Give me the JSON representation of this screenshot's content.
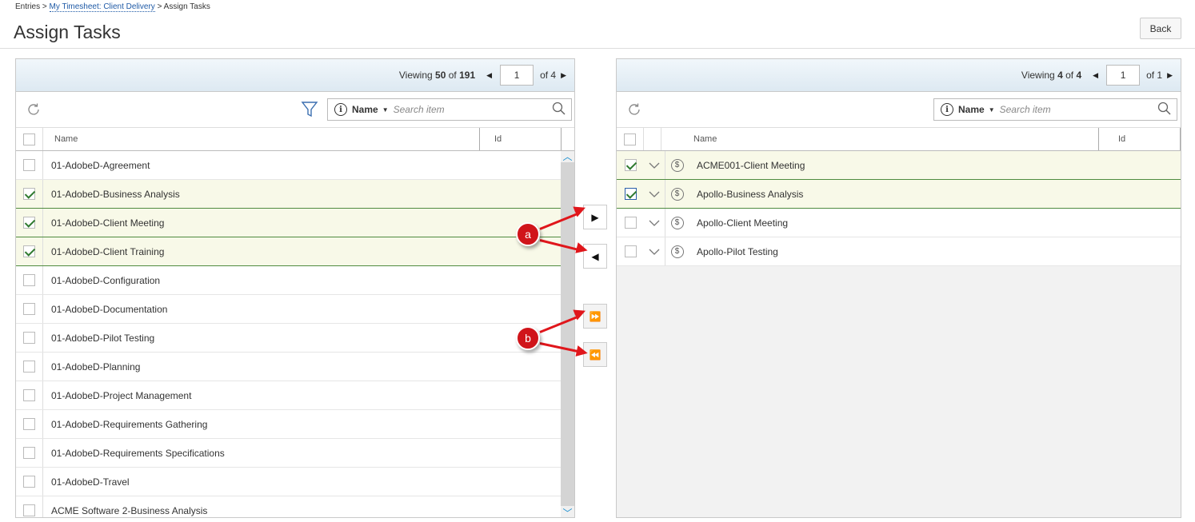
{
  "breadcrumb": {
    "root": "Entries",
    "sep1": " > ",
    "link": "My Timesheet: Client Delivery",
    "sep2": " > ",
    "current": "Assign Tasks"
  },
  "page_title": "Assign Tasks",
  "back_label": "Back",
  "left_panel": {
    "viewing_label": "Viewing",
    "viewing_count": "50",
    "viewing_of": "of",
    "viewing_total": "191",
    "page_value": "1",
    "page_of": "of 4",
    "search": {
      "field": "Name",
      "placeholder": "Search item"
    },
    "columns": {
      "name": "Name",
      "id": "Id"
    },
    "rows": [
      {
        "name": "01-AdobeD-Agreement",
        "checked": false
      },
      {
        "name": "01-AdobeD-Business Analysis",
        "checked": true
      },
      {
        "name": "01-AdobeD-Client Meeting",
        "checked": true
      },
      {
        "name": "01-AdobeD-Client Training",
        "checked": true
      },
      {
        "name": "01-AdobeD-Configuration",
        "checked": false
      },
      {
        "name": "01-AdobeD-Documentation",
        "checked": false
      },
      {
        "name": "01-AdobeD-Pilot Testing",
        "checked": false
      },
      {
        "name": "01-AdobeD-Planning",
        "checked": false
      },
      {
        "name": "01-AdobeD-Project Management",
        "checked": false
      },
      {
        "name": "01-AdobeD-Requirements Gathering",
        "checked": false
      },
      {
        "name": "01-AdobeD-Requirements Specifications",
        "checked": false
      },
      {
        "name": "01-AdobeD-Travel",
        "checked": false
      },
      {
        "name": "ACME Software 2-Business Analysis",
        "checked": false
      }
    ]
  },
  "right_panel": {
    "viewing_label": "Viewing",
    "viewing_count": "4",
    "viewing_of": "of",
    "viewing_total": "4",
    "page_value": "1",
    "page_of": "of 1",
    "search": {
      "field": "Name",
      "placeholder": "Search item"
    },
    "columns": {
      "name": "Name",
      "id": "Id"
    },
    "rows": [
      {
        "name": "ACME001-Client Meeting",
        "checked": true
      },
      {
        "name": "Apollo-Business Analysis",
        "checked": true
      },
      {
        "name": "Apollo-Client Meeting",
        "checked": false
      },
      {
        "name": "Apollo-Pilot Testing",
        "checked": false
      }
    ]
  },
  "transfer_buttons": {
    "move_right": "▶",
    "move_left": "◀",
    "move_all_right": "⏩",
    "move_all_left": "⏪"
  },
  "annotations": {
    "a": "a",
    "b": "b"
  },
  "colors": {
    "accent_red": "#e0161b",
    "check_green": "#2f7a2f",
    "selected_row": "#f8f9e8",
    "pager_bg": "#e4eef5"
  }
}
